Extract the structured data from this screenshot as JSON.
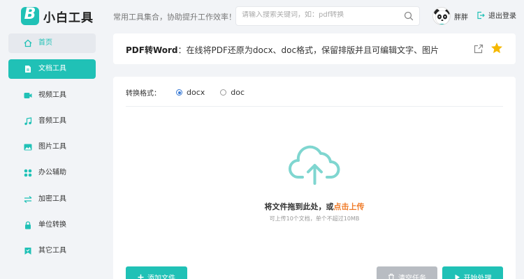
{
  "header": {
    "logo_text": "小白工具",
    "slogan": "常用工具集合，协助提升工作效率！",
    "search_placeholder": "请输入搜索关键词，如：pdf转换",
    "username": "胖胖",
    "logout": "退出登录"
  },
  "sidebar": {
    "items": [
      {
        "label": "首页",
        "icon": "home-icon"
      },
      {
        "label": "文档工具",
        "icon": "document-icon"
      },
      {
        "label": "视频工具",
        "icon": "video-icon"
      },
      {
        "label": "音频工具",
        "icon": "music-icon"
      },
      {
        "label": "图片工具",
        "icon": "image-icon"
      },
      {
        "label": "办公辅助",
        "icon": "grid-icon"
      },
      {
        "label": "加密工具",
        "icon": "swap-icon"
      },
      {
        "label": "单位转换",
        "icon": "lock-icon"
      },
      {
        "label": "其它工具",
        "icon": "bookmark-icon"
      }
    ],
    "active_index": 1
  },
  "titlebar": {
    "tool_name": "PDF转Word",
    "description": "：在线将PDF还原为docx、doc格式，保留排版并且可编辑文字、图片"
  },
  "converter": {
    "format_label": "转换格式：",
    "options": [
      "docx",
      "doc"
    ],
    "selected": "docx",
    "drop_text": "将文件拖到此处，或",
    "drop_link": "点击上传",
    "drop_hint": "可上传10个文档，单个不超过10MB",
    "add_button": "添加文件",
    "clear_button": "清空任务",
    "start_button": "开始处理"
  },
  "colors": {
    "accent": "#20c1b6",
    "link": "#f07c2a",
    "star": "#f5b800"
  }
}
